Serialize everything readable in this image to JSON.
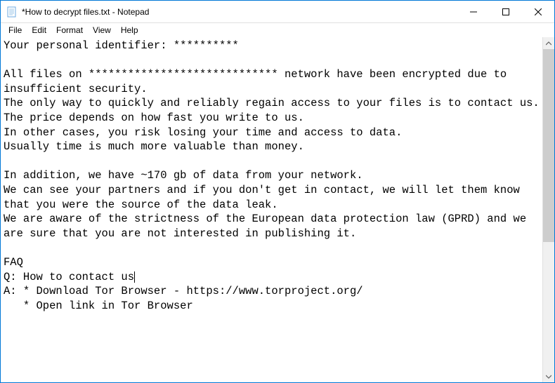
{
  "window": {
    "title": "*How to decrypt files.txt - Notepad"
  },
  "menu": {
    "file": "File",
    "edit": "Edit",
    "format": "Format",
    "view": "View",
    "help": "Help"
  },
  "document": {
    "content": "Your personal identifier: **********\n\nAll files on ***************************** network have been encrypted due to insufficient security.\nThe only way to quickly and reliably regain access to your files is to contact us.\nThe price depends on how fast you write to us.\nIn other cases, you risk losing your time and access to data.\nUsually time is much more valuable than money.\n\nIn addition, we have ~170 gb of data from your network.\nWe can see your partners and if you don't get in contact, we will let them know that you were the source of the data leak.\nWe are aware of the strictness of the European data protection law (GPRD) and we are sure that you are not interested in publishing it.\n\nFAQ\nQ: How to contact us",
    "content_after_caret": "\nA: * Download Tor Browser - https://www.torproject.org/\n   * Open link in Tor Browser"
  }
}
